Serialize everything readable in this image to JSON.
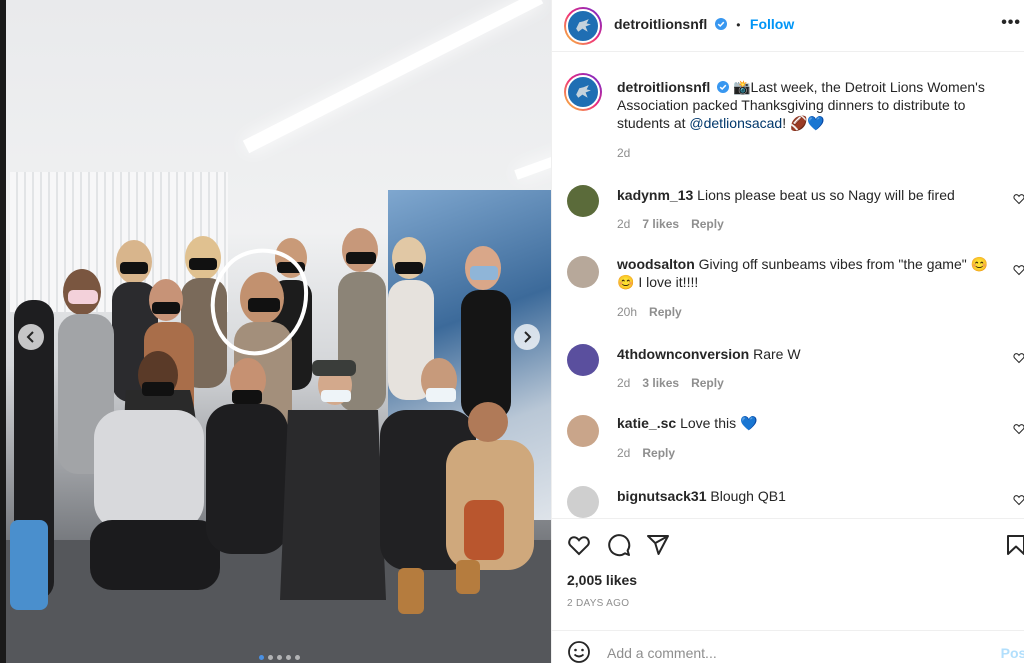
{
  "post": {
    "username": "detroitlionsnfl",
    "follow_label": "Follow",
    "separator": "•",
    "caption_emoji": "📸",
    "caption_text": "Last week, the Detroit Lions Women's Association packed Thanksgiving dinners to distribute to students at ",
    "caption_mention": "@detlionsacad",
    "caption_end": "! 🏈💙",
    "caption_time": "2d",
    "more_label": "•••"
  },
  "comments": [
    {
      "username": "kadynm_13",
      "text": "Lions please beat us so Nagy will be fired",
      "time": "2d",
      "likes": "7 likes",
      "reply": "Reply",
      "avatar_color": "#5b6b3a"
    },
    {
      "username": "woodsalton",
      "text": "Giving off sunbeams vibes from \"the game\" 😊😊 I love it!!!!",
      "time": "20h",
      "likes": "",
      "reply": "Reply",
      "avatar_color": "#b7a89a"
    },
    {
      "username": "4thdownconversion",
      "text": "Rare W",
      "time": "2d",
      "likes": "3 likes",
      "reply": "Reply",
      "avatar_color": "#5a4f9e"
    },
    {
      "username": "katie_.sc",
      "text": "Love this 💙",
      "time": "2d",
      "likes": "",
      "reply": "Reply",
      "avatar_color": "#c9a58a"
    },
    {
      "username": "bignutsack31",
      "text": "Blough QB1",
      "time": "",
      "likes": "",
      "reply": "",
      "avatar_color": "#cfcfcf"
    }
  ],
  "engagement": {
    "likes": "2,005 likes",
    "date": "2 DAYS AGO"
  },
  "composer": {
    "placeholder": "Add a comment...",
    "post_label": "Post"
  },
  "carousel": {
    "total": 5,
    "active_index": 0
  },
  "colors": {
    "brand_blue": "#0095f6",
    "lions_blue": "#1f6eb3",
    "muted": "#8e8e8e"
  },
  "icons": [
    "lion-logo-icon",
    "verified-icon",
    "heart-icon",
    "comment-icon",
    "share-icon",
    "bookmark-icon",
    "emoji-icon",
    "chevron-left-icon",
    "chevron-right-icon",
    "more-icon"
  ]
}
